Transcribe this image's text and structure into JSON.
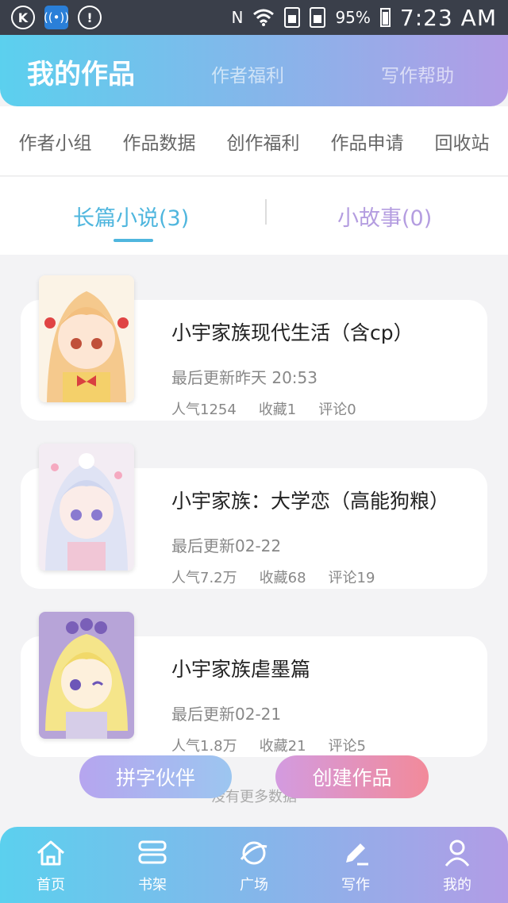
{
  "status_bar": {
    "icons": [
      "k-icon",
      "wifi-hotspot-icon",
      "alert-icon",
      "nfc-icon",
      "wifi-icon",
      "sim1-icon",
      "sim2-icon",
      "battery-icon"
    ],
    "nfc": "N",
    "battery": "95%",
    "time": "7:23 AM"
  },
  "header": {
    "tabs": [
      "我的作品",
      "作者福利",
      "写作帮助"
    ]
  },
  "subnav": {
    "items": [
      "作者小组",
      "作品数据",
      "创作福利",
      "作品申请",
      "回收站"
    ]
  },
  "type_tabs": {
    "novel": "长篇小说(3)",
    "story": "小故事(0)"
  },
  "works": [
    {
      "title": "小宇家族现代生活（含cp）",
      "updated": "最后更新昨天 20:53",
      "popularity": "人气1254",
      "favorites": "收藏1",
      "comments": "评论0"
    },
    {
      "title": "小宇家族：大学恋（高能狗粮）",
      "updated": "最后更新02-22",
      "popularity": "人气7.2万",
      "favorites": "收藏68",
      "comments": "评论19"
    },
    {
      "title": "小宇家族虐墨篇",
      "updated": "最后更新02-21",
      "popularity": "人气1.8万",
      "favorites": "收藏21",
      "comments": "评论5"
    }
  ],
  "buttons": {
    "partner": "拼字伙伴",
    "create": "创建作品"
  },
  "no_more": "没有更多数据",
  "bottom_nav": [
    {
      "label": "首页",
      "icon": "home-icon"
    },
    {
      "label": "书架",
      "icon": "bookshelf-icon"
    },
    {
      "label": "广场",
      "icon": "planet-icon"
    },
    {
      "label": "写作",
      "icon": "pen-icon"
    },
    {
      "label": "我的",
      "icon": "user-icon"
    }
  ],
  "colors": {
    "accent_blue": "#4fb6de",
    "accent_purple": "#b49de0",
    "gradient_start": "#5bd0ee",
    "gradient_end": "#b29ce6"
  }
}
